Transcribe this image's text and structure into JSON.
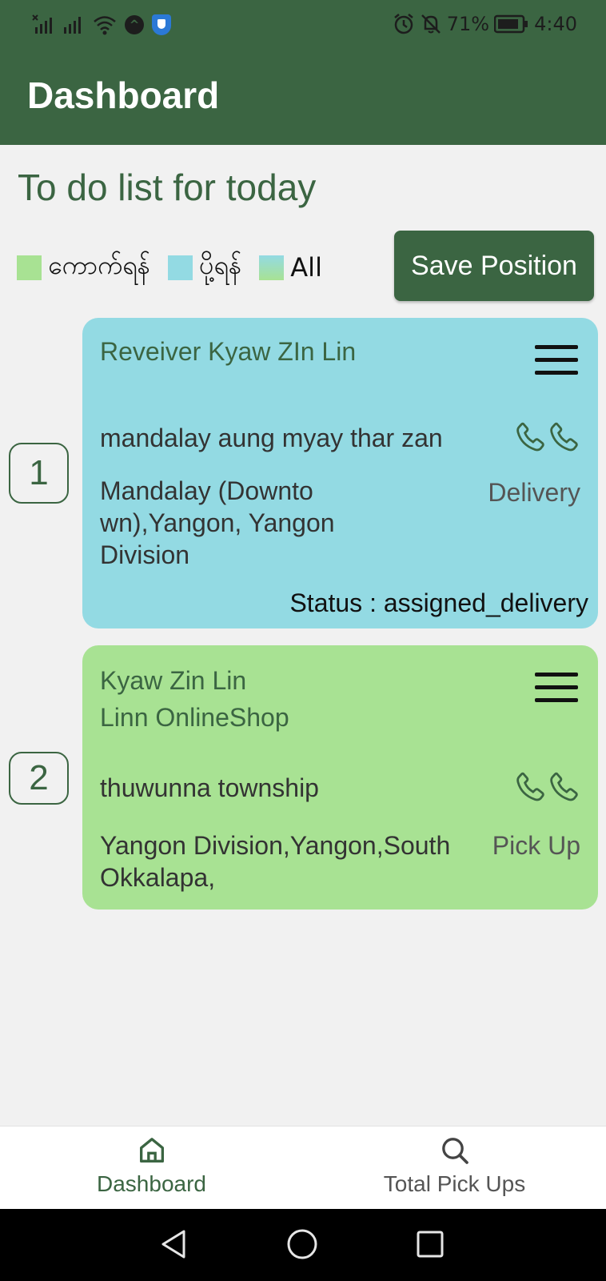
{
  "status_bar": {
    "battery_percent": "71%",
    "time": "4:40",
    "icons": [
      "no-sim-signal-icon",
      "signal-icon",
      "wifi-icon",
      "nav-app-icon",
      "shield-app-icon",
      "alarm-icon",
      "notifications-off-icon",
      "battery-icon"
    ]
  },
  "app_bar": {
    "title": "Dashboard"
  },
  "heading": "To do list for today",
  "legend": {
    "items": [
      {
        "label": "ကောက်ရန်",
        "color": "#a8e293"
      },
      {
        "label": "ပို့ရန်",
        "color": "#93dae3"
      },
      {
        "label": "All",
        "color": "#a8e293"
      }
    ]
  },
  "save_button": {
    "label": "Save Position"
  },
  "tasks": [
    {
      "index": "1",
      "receiver": "Reveiver Kyaw ZIn Lin",
      "shop": "",
      "area": "mandalay aung myay thar zan",
      "address_line1": "Mandalay (Downto",
      "address_line2": "wn),Yangon, Yangon",
      "address_line3": "Division",
      "type": "Delivery",
      "status": "Status : assigned_delivery",
      "color": "#93dae3"
    },
    {
      "index": "2",
      "receiver": "Kyaw Zin Lin",
      "shop": "Linn OnlineShop",
      "area": "thuwunna township",
      "address_line1": "Yangon Division,Yangon,South",
      "address_line2": "Okkalapa,",
      "type": "Pick Up",
      "color": "#a8e293"
    }
  ],
  "bottom_nav": {
    "items": [
      {
        "label": "Dashboard",
        "icon": "home-icon",
        "active": true
      },
      {
        "label": "Total Pick Ups",
        "icon": "search-icon",
        "active": false
      }
    ]
  },
  "system_nav": {
    "icons": [
      "back-icon",
      "home-circle-icon",
      "recents-icon"
    ]
  },
  "colors": {
    "primary": "#3b6542",
    "pickup": "#a8e293",
    "delivery": "#93dae3",
    "background": "#f1f1f1"
  }
}
